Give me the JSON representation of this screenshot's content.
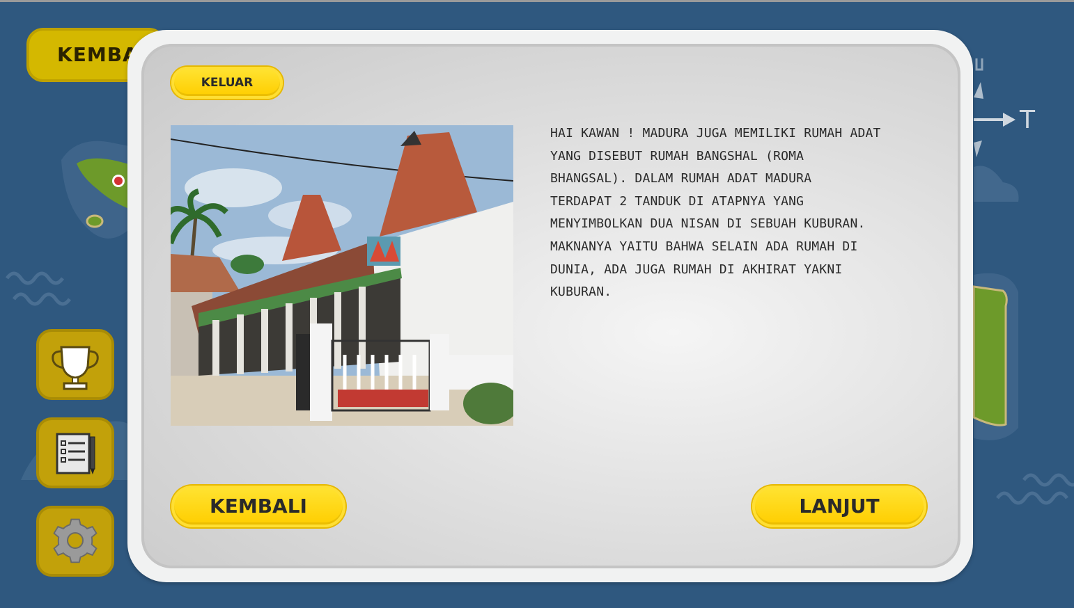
{
  "background": {
    "back_label": "KEMBAL",
    "compass_east": "T",
    "side_buttons": [
      {
        "icon": "trophy-icon"
      },
      {
        "icon": "checklist-icon"
      },
      {
        "icon": "gear-icon"
      }
    ]
  },
  "modal": {
    "exit_label": "KELUAR",
    "photo_icon": "traditional-house-photo",
    "text_lines": [
      "HAI KAWAN ! MADURA JUGA MEMILIKI RUMAH ADAT",
      "YANG DISEBUT RUMAH BANGSHAL (ROMA",
      "BHANGSAL). DALAM RUMAH ADAT MADURA",
      "TERDAPAT 2 TANDUK DI ATAPNYA YANG",
      "MENYIMBOLKAN DUA NISAN DI SEBUAH KUBURAN.",
      "MAKNANYA YAITU BAHWA SELAIN ADA RUMAH DI",
      "DUNIA, ADA JUGA RUMAH DI AKHIRAT YAKNI",
      "KUBURAN."
    ],
    "back_label": "KEMBALI",
    "next_label": "LANJUT"
  },
  "colors": {
    "background": "#2f587f",
    "button_yellow": "#ffd400",
    "panel": "#dcdcdc"
  }
}
